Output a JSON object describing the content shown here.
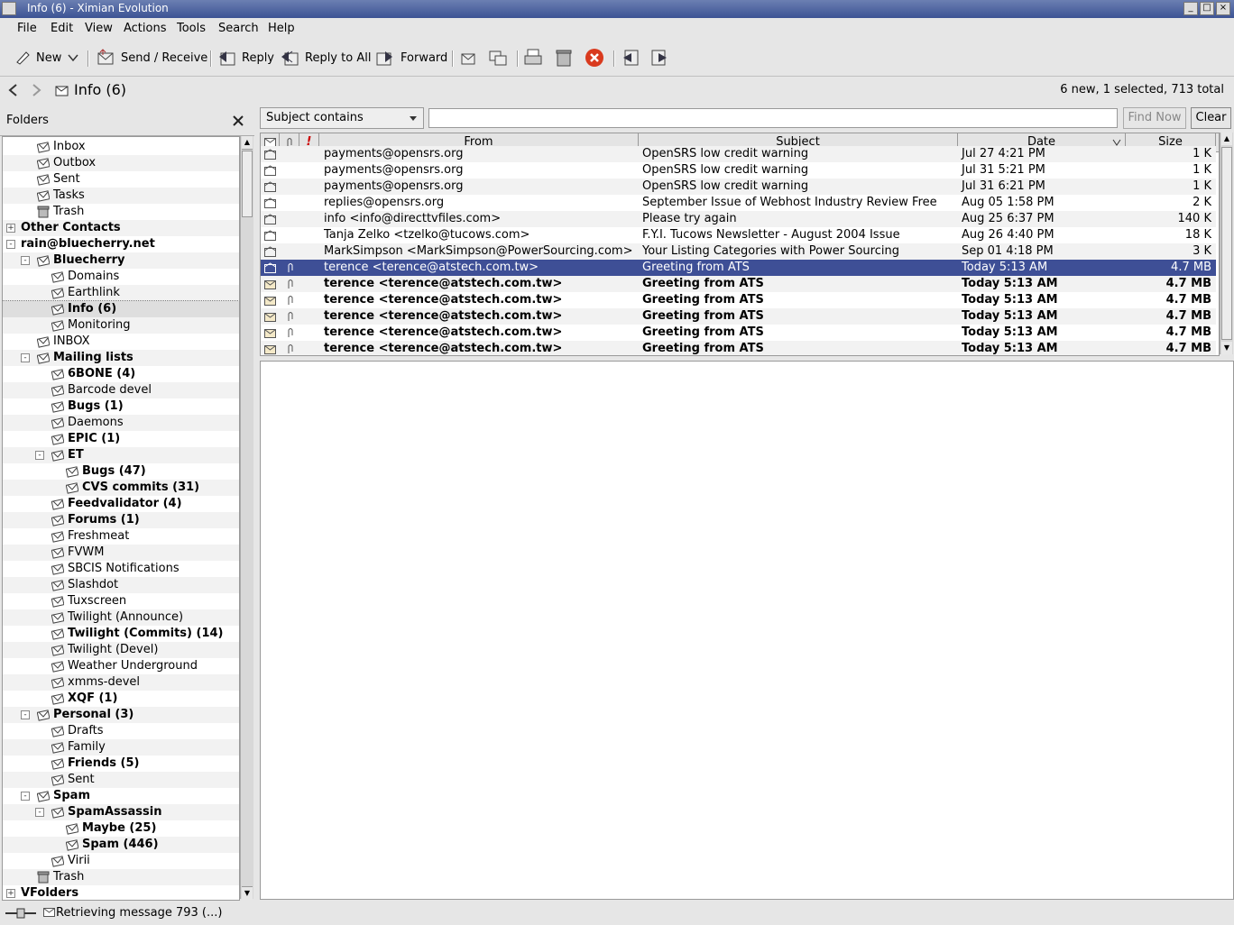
{
  "window": {
    "title": "Info (6) - Ximian Evolution"
  },
  "menu": [
    "File",
    "Edit",
    "View",
    "Actions",
    "Tools",
    "Search",
    "Help"
  ],
  "toolbar": {
    "new": "New",
    "send_receive": "Send / Receive",
    "reply": "Reply",
    "reply_all": "Reply to All",
    "forward": "Forward"
  },
  "nav": {
    "folder_label": "Info (6)",
    "counts": "6 new, 1 selected, 713 total"
  },
  "folders": {
    "header": "Folders",
    "items": [
      {
        "label": "Inbox",
        "icon": "inbox-icon",
        "depth": 1,
        "bold": false
      },
      {
        "label": "Outbox",
        "icon": "outbox-icon",
        "depth": 1,
        "bold": false
      },
      {
        "label": "Sent",
        "icon": "folder-icon",
        "depth": 1,
        "bold": false
      },
      {
        "label": "Tasks",
        "icon": "folder-icon",
        "depth": 1,
        "bold": false
      },
      {
        "label": "Trash",
        "icon": "trash-icon",
        "depth": 1,
        "bold": false
      },
      {
        "label": "Other Contacts",
        "icon": "",
        "depth": 0,
        "bold": true,
        "expander": "+"
      },
      {
        "label": "rain@bluecherry.net",
        "icon": "",
        "depth": 0,
        "bold": true,
        "expander": "-"
      },
      {
        "label": "Bluecherry",
        "icon": "folder-icon",
        "depth": 1,
        "bold": true,
        "expander": "-"
      },
      {
        "label": "Domains",
        "icon": "folder-icon",
        "depth": 2,
        "bold": false
      },
      {
        "label": "Earthlink",
        "icon": "folder-icon",
        "depth": 2,
        "bold": false
      },
      {
        "label": "Info (6)",
        "icon": "folder-icon",
        "depth": 2,
        "bold": true,
        "selected": true
      },
      {
        "label": "Monitoring",
        "icon": "folder-icon",
        "depth": 2,
        "bold": false
      },
      {
        "label": "INBOX",
        "icon": "folder-icon",
        "depth": 1,
        "bold": false
      },
      {
        "label": "Mailing lists",
        "icon": "folder-icon",
        "depth": 1,
        "bold": true,
        "expander": "-"
      },
      {
        "label": "6BONE (4)",
        "icon": "folder-icon",
        "depth": 2,
        "bold": true
      },
      {
        "label": "Barcode devel",
        "icon": "folder-icon",
        "depth": 2,
        "bold": false
      },
      {
        "label": "Bugs (1)",
        "icon": "folder-icon",
        "depth": 2,
        "bold": true
      },
      {
        "label": "Daemons",
        "icon": "folder-icon",
        "depth": 2,
        "bold": false
      },
      {
        "label": "EPIC (1)",
        "icon": "folder-icon",
        "depth": 2,
        "bold": true
      },
      {
        "label": "ET",
        "icon": "folder-icon",
        "depth": 2,
        "bold": true,
        "expander": "-"
      },
      {
        "label": "Bugs (47)",
        "icon": "folder-icon",
        "depth": 3,
        "bold": true
      },
      {
        "label": "CVS commits (31)",
        "icon": "folder-icon",
        "depth": 3,
        "bold": true
      },
      {
        "label": "Feedvalidator (4)",
        "icon": "folder-icon",
        "depth": 2,
        "bold": true
      },
      {
        "label": "Forums (1)",
        "icon": "folder-icon",
        "depth": 2,
        "bold": true
      },
      {
        "label": "Freshmeat",
        "icon": "folder-icon",
        "depth": 2,
        "bold": false
      },
      {
        "label": "FVWM",
        "icon": "folder-icon",
        "depth": 2,
        "bold": false
      },
      {
        "label": "SBCIS Notifications",
        "icon": "folder-icon",
        "depth": 2,
        "bold": false
      },
      {
        "label": "Slashdot",
        "icon": "folder-icon",
        "depth": 2,
        "bold": false
      },
      {
        "label": "Tuxscreen",
        "icon": "folder-icon",
        "depth": 2,
        "bold": false
      },
      {
        "label": "Twilight (Announce)",
        "icon": "folder-icon",
        "depth": 2,
        "bold": false
      },
      {
        "label": "Twilight (Commits) (14)",
        "icon": "folder-icon",
        "depth": 2,
        "bold": true
      },
      {
        "label": "Twilight (Devel)",
        "icon": "folder-icon",
        "depth": 2,
        "bold": false
      },
      {
        "label": "Weather Underground",
        "icon": "folder-icon",
        "depth": 2,
        "bold": false
      },
      {
        "label": "xmms-devel",
        "icon": "folder-icon",
        "depth": 2,
        "bold": false
      },
      {
        "label": "XQF (1)",
        "icon": "folder-icon",
        "depth": 2,
        "bold": true
      },
      {
        "label": "Personal (3)",
        "icon": "folder-icon",
        "depth": 1,
        "bold": true,
        "expander": "-"
      },
      {
        "label": "Drafts",
        "icon": "folder-icon",
        "depth": 2,
        "bold": false
      },
      {
        "label": "Family",
        "icon": "folder-icon",
        "depth": 2,
        "bold": false
      },
      {
        "label": "Friends (5)",
        "icon": "folder-icon",
        "depth": 2,
        "bold": true
      },
      {
        "label": "Sent",
        "icon": "folder-icon",
        "depth": 2,
        "bold": false
      },
      {
        "label": "Spam",
        "icon": "folder-icon",
        "depth": 1,
        "bold": true,
        "expander": "-"
      },
      {
        "label": "SpamAssassin",
        "icon": "folder-icon",
        "depth": 2,
        "bold": true,
        "expander": "-"
      },
      {
        "label": "Maybe (25)",
        "icon": "folder-icon",
        "depth": 3,
        "bold": true
      },
      {
        "label": "Spam (446)",
        "icon": "folder-icon",
        "depth": 3,
        "bold": true
      },
      {
        "label": "Virii",
        "icon": "folder-icon",
        "depth": 2,
        "bold": false
      },
      {
        "label": "Trash",
        "icon": "trash-icon",
        "depth": 1,
        "bold": false
      },
      {
        "label": "VFolders",
        "icon": "",
        "depth": 0,
        "bold": true,
        "expander": "+"
      }
    ]
  },
  "search": {
    "criteria": "Subject contains",
    "value": "",
    "find_now": "Find Now",
    "clear": "Clear"
  },
  "columns": {
    "from": "From",
    "subject": "Subject",
    "date": "Date",
    "size": "Size"
  },
  "messages": [
    {
      "from": "payments@opensrs.org",
      "subject": "OpenSRS low credit warning",
      "date": "Jul 27 4:21 PM",
      "size": "1 K",
      "unread": false,
      "attachment": false
    },
    {
      "from": "payments@opensrs.org",
      "subject": "OpenSRS low credit warning",
      "date": "Jul 31 5:21 PM",
      "size": "1 K",
      "unread": false,
      "attachment": false
    },
    {
      "from": "payments@opensrs.org",
      "subject": "OpenSRS low credit warning",
      "date": "Jul 31 6:21 PM",
      "size": "1 K",
      "unread": false,
      "attachment": false
    },
    {
      "from": "replies@opensrs.org",
      "subject": "September Issue of Webhost Industry Review Free",
      "date": "Aug 05 1:58 PM",
      "size": "2 K",
      "unread": false,
      "attachment": false
    },
    {
      "from": "info <info@directtvfiles.com>",
      "subject": "Please try again",
      "date": "Aug 25 6:37 PM",
      "size": "140 K",
      "unread": false,
      "attachment": false
    },
    {
      "from": "Tanja Zelko <tzelko@tucows.com>",
      "subject": "F.Y.I. Tucows Newsletter - August 2004 Issue",
      "date": "Aug 26 4:40 PM",
      "size": "18 K",
      "unread": false,
      "attachment": false
    },
    {
      "from": "MarkSimpson <MarkSimpson@PowerSourcing.com>",
      "subject": "Your Listing Categories with Power Sourcing",
      "date": "Sep 01 4:18 PM",
      "size": "3 K",
      "unread": false,
      "attachment": false
    },
    {
      "from": "terence <terence@atstech.com.tw>",
      "subject": "Greeting from ATS",
      "date": "Today 5:13 AM",
      "size": "4.7 MB",
      "unread": false,
      "attachment": true,
      "selected": true
    },
    {
      "from": "terence <terence@atstech.com.tw>",
      "subject": "Greeting from ATS",
      "date": "Today 5:13 AM",
      "size": "4.7 MB",
      "unread": true,
      "attachment": true
    },
    {
      "from": "terence <terence@atstech.com.tw>",
      "subject": "Greeting from ATS",
      "date": "Today 5:13 AM",
      "size": "4.7 MB",
      "unread": true,
      "attachment": true
    },
    {
      "from": "terence <terence@atstech.com.tw>",
      "subject": "Greeting from ATS",
      "date": "Today 5:13 AM",
      "size": "4.7 MB",
      "unread": true,
      "attachment": true
    },
    {
      "from": "terence <terence@atstech.com.tw>",
      "subject": "Greeting from ATS",
      "date": "Today 5:13 AM",
      "size": "4.7 MB",
      "unread": true,
      "attachment": true
    },
    {
      "from": "terence <terence@atstech.com.tw>",
      "subject": "Greeting from ATS",
      "date": "Today 5:13 AM",
      "size": "4.7 MB",
      "unread": true,
      "attachment": true
    }
  ],
  "status": {
    "text": "Retrieving message 793 (...)"
  },
  "colors": {
    "titlebar": "#3c5394",
    "selection": "#3e4f96",
    "stop_button": "#d93a1e"
  }
}
